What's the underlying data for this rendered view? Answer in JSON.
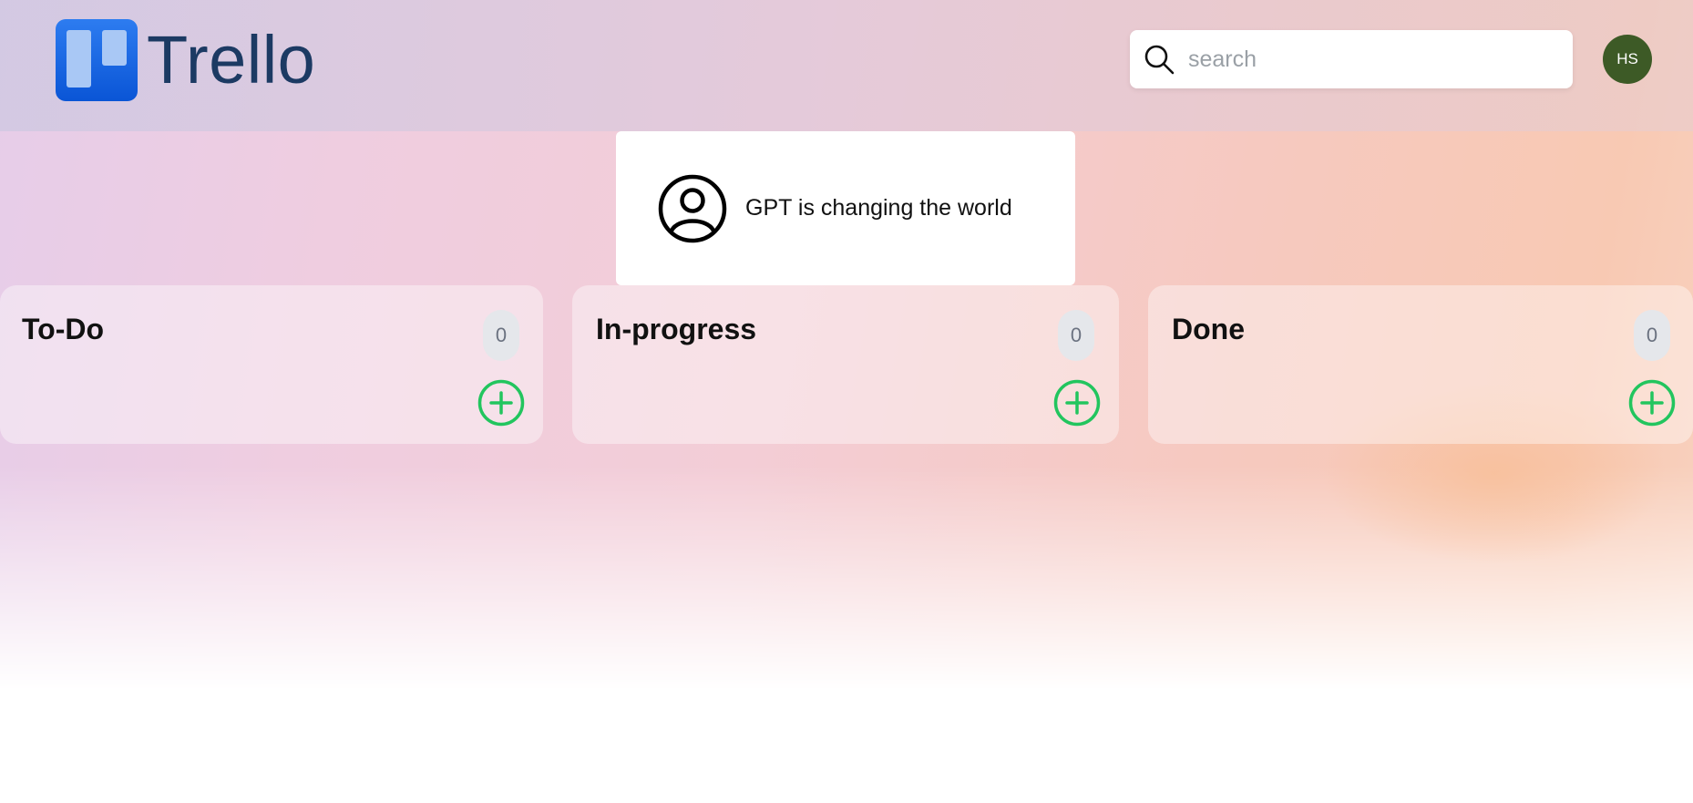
{
  "header": {
    "logo_text": "Trello",
    "search": {
      "placeholder": "search",
      "value": ""
    },
    "avatar_initials": "HS"
  },
  "notice": {
    "text": "GPT is changing the world",
    "icon": "user-circle-icon"
  },
  "columns": [
    {
      "title": "To-Do",
      "count": "0"
    },
    {
      "title": "In-progress",
      "count": "0"
    },
    {
      "title": "Done",
      "count": "0"
    }
  ],
  "colors": {
    "logo_blue": "#0a55d6",
    "logo_text": "#1c3a63",
    "avatar_bg": "#3d5a26",
    "add_green": "#22c55e",
    "count_bg": "#e5e7eb"
  }
}
